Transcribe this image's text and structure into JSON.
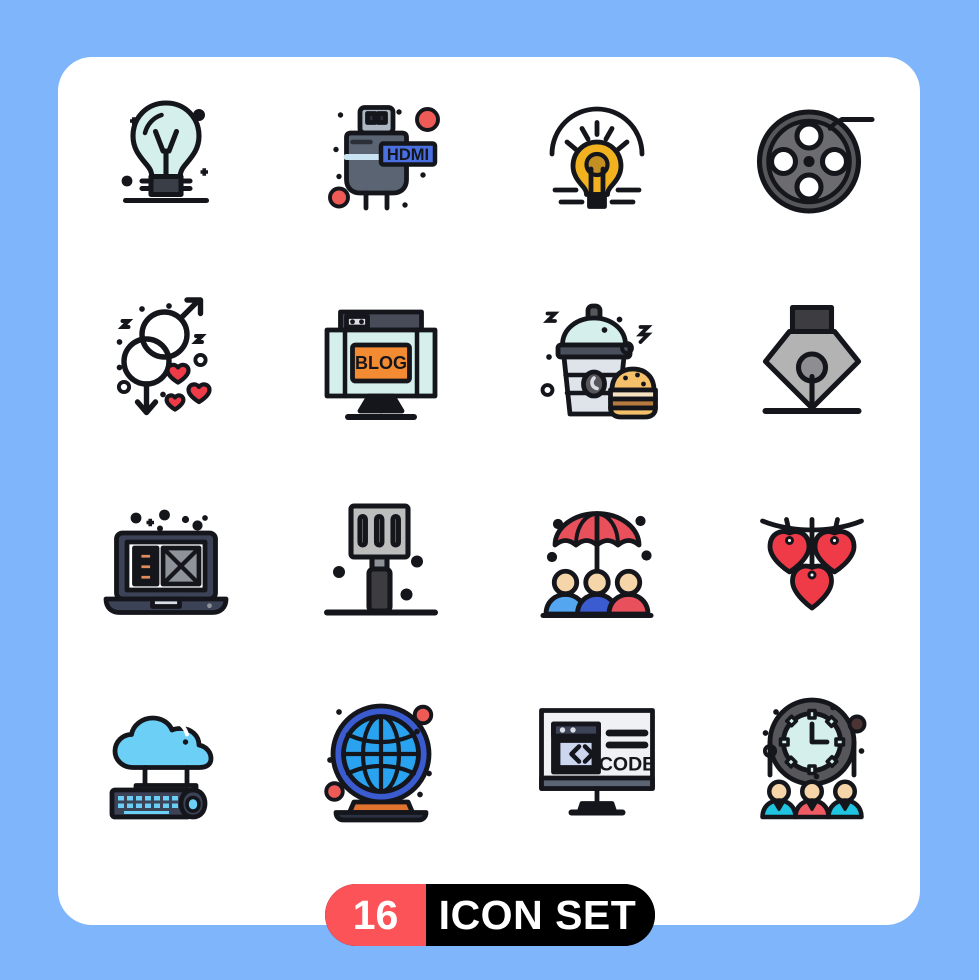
{
  "canvas": {
    "background_color": "#7fb5fb",
    "card_color": "#ffffff"
  },
  "badge": {
    "count": "16",
    "label": "ICON SET",
    "count_bg": "#fb5358",
    "label_bg": "#000000",
    "text_color": "#ffffff"
  },
  "palette": {
    "outline": "#14161c",
    "mint": "#d4efec",
    "slate": "#5b6472",
    "slate_light": "#8d96a3",
    "blue_label": "#4a6fe0",
    "red": "#ee3b47",
    "yellow": "#f2b21f",
    "orange": "#f38b33",
    "gray": "#b3b3b3",
    "dark_gray": "#57575b",
    "sky": "#6ccff6",
    "royal_blue": "#3b5bd1",
    "skin": "#f6d6a8",
    "teal": "#21c4e0"
  },
  "icons": [
    {
      "index": 1,
      "name": "light-bulb-idea",
      "label": "Light Bulb"
    },
    {
      "index": 2,
      "name": "hdmi-connector",
      "label": "HDMI",
      "text": "HDMI"
    },
    {
      "index": 3,
      "name": "glowing-idea-bulb",
      "label": "Idea"
    },
    {
      "index": 4,
      "name": "film-reel",
      "label": "Film Reel"
    },
    {
      "index": 5,
      "name": "gender-symbols-hearts",
      "label": "Gender"
    },
    {
      "index": 6,
      "name": "blog-monitor",
      "label": "Blog",
      "text": "BLOG"
    },
    {
      "index": 7,
      "name": "drink-and-burger",
      "label": "Fast Food"
    },
    {
      "index": 8,
      "name": "pen-nib",
      "label": "Pen Nib"
    },
    {
      "index": 9,
      "name": "laptop-email-layout",
      "label": "Laptop"
    },
    {
      "index": 10,
      "name": "grill-spatula",
      "label": "Spatula"
    },
    {
      "index": 11,
      "name": "umbrella-insurance-people",
      "label": "Insurance"
    },
    {
      "index": 12,
      "name": "hanging-hearts",
      "label": "Hanging Hearts"
    },
    {
      "index": 13,
      "name": "cloud-computing-keyboard",
      "label": "Cloud Computing"
    },
    {
      "index": 14,
      "name": "globe-stand",
      "label": "Globe"
    },
    {
      "index": 15,
      "name": "code-monitor",
      "label": "Code",
      "text": "CODE"
    },
    {
      "index": 16,
      "name": "clock-team-schedule",
      "label": "Schedule"
    }
  ]
}
